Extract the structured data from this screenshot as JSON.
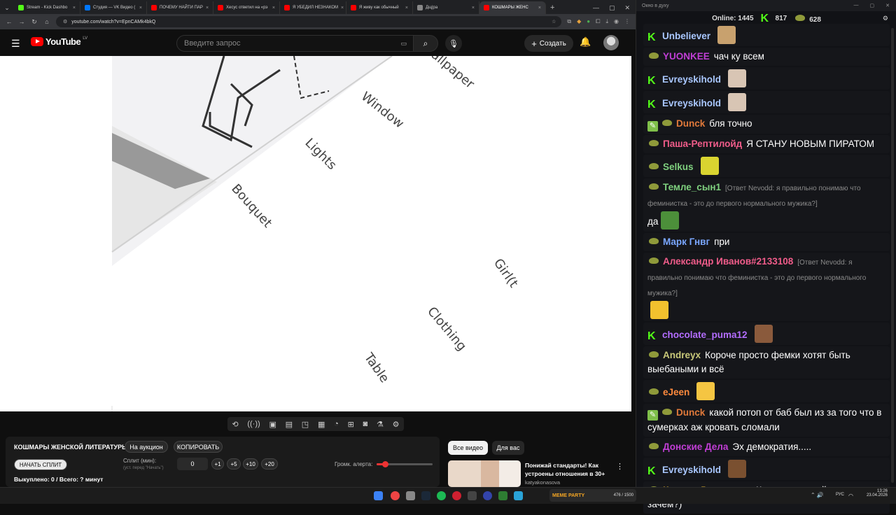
{
  "browser": {
    "tabs": [
      {
        "title": "Stream - Kick Dashbo",
        "color": "#53fc18"
      },
      {
        "title": "Студия — VK Видео (",
        "color": "#0077ff"
      },
      {
        "title": "ПОЧЕМУ НАЙТИ ПАР",
        "color": "#ff0000"
      },
      {
        "title": "Хесус ответил на «рэ",
        "color": "#ff0000"
      },
      {
        "title": "Я УБЕДИЛ НЕЗНАКОМ",
        "color": "#ff0000"
      },
      {
        "title": "Я живу как обычный",
        "color": "#ff0000"
      },
      {
        "title": "Дщ|ра",
        "color": "#888888"
      },
      {
        "title": "КОШМАРЫ ЖЕНС",
        "color": "#ff0000",
        "active": true
      }
    ],
    "url": "youtube.com/watch?v=EpnCAMk4bkQ"
  },
  "youtube": {
    "logo_text": "YouTube",
    "region": "LV",
    "search_placeholder": "Введите запрос",
    "create_label": "Создать"
  },
  "video_words": [
    "Window",
    "Lights",
    "Bouquet",
    "Clothing",
    "Table",
    "Girl(t",
    "allpaper"
  ],
  "panel": {
    "title": "КОШМАРЫ ЖЕНСКОЙ ЛИТЕРАТУРЫ",
    "auction_btn": "На аукцион",
    "copy_btn": "КОПИРОВАТЬ",
    "start_split_btn": "НАЧАТЬ СПЛИТ",
    "split_label": "Сплит (мин):",
    "split_hint": "(уст. перед \"Начать\")",
    "split_value": "0",
    "inc_buttons": [
      "+1",
      "+5",
      "+10",
      "+20"
    ],
    "volume_label": "Громк. алерта:",
    "volume_level": 0.15,
    "bought_text": "Выкуплено: 0 / Всего: ? минут"
  },
  "recs": {
    "chips": [
      "Все видео",
      "Для вас"
    ],
    "video_title": "Понижай стандарты! Как устроены отношения в 30+",
    "channel": "katyakonasova"
  },
  "chat": {
    "window_title": "Окно в духу",
    "online_label": "Online:",
    "online_count": "1445",
    "kick_count": "817",
    "vk_count": "628",
    "messages": [
      {
        "badge": "kick",
        "name": "Unbeliever",
        "color": "#a9c7ff",
        "text": "",
        "emote": "#c8a16e"
      },
      {
        "badge": "frog",
        "name": "YUONKEE",
        "color": "#c13ed6",
        "text": "чач ку всем"
      },
      {
        "badge": "kick",
        "name": "Evreyskihold",
        "color": "#a9c7ff",
        "text": "",
        "emote": "#d8c5b4"
      },
      {
        "badge": "kick",
        "name": "Evreyskihold",
        "color": "#a9c7ff",
        "text": "",
        "emote": "#d8c5b4"
      },
      {
        "badge": "modfrog",
        "name": "Dunck",
        "color": "#e0793a",
        "text": "бля точно"
      },
      {
        "badge": "frog",
        "name": "Паша-Рептилойд",
        "color": "#f05c8a",
        "text": "Я СТАНУ НОВЫМ ПИРАТОМ"
      },
      {
        "badge": "frog",
        "name": "Selkus",
        "color": "#7fd17f",
        "text": "",
        "emote": "#d9d430"
      },
      {
        "badge": "frog",
        "name": "Темле_сын1",
        "color": "#7fd17f",
        "reply": "[Ответ Nevodd: я правильно понимаю что феминистка - это до первого нормального мужика?]",
        "text": "да",
        "emote": "#4c8f3a"
      },
      {
        "badge": "frog",
        "name": "Марк Гнвг",
        "color": "#7aa7ff",
        "text": "при"
      },
      {
        "badge": "frog",
        "name": "Александр Иванов#2133108",
        "color": "#f05c8a",
        "reply": "[Ответ Nevodd: я правильно понимаю что феминистка - это до первого нормального мужика?]",
        "text": "",
        "emote": "#f2c12e"
      },
      {
        "badge": "kick",
        "name": "chocolate_puma12",
        "color": "#b36dff",
        "text": "",
        "emote": "#8a5a3c"
      },
      {
        "badge": "frog",
        "name": "Andreyx",
        "color": "#c9c97a",
        "text": "Короче просто фемки хотят быть выебаными и всё"
      },
      {
        "badge": "frog",
        "name": "eJeen",
        "color": "#ff8a3d",
        "text": "",
        "emote": "#f5c542"
      },
      {
        "badge": "modfrog",
        "name": "Dunck",
        "color": "#e0793a",
        "text": "какой потоп от баб был из за того что в сумерках аж кровать сломали"
      },
      {
        "badge": "frog",
        "name": "Донские Дела",
        "color": "#c13ed6",
        "text": "Эх демократия....."
      },
      {
        "badge": "kick",
        "name": "Evreyskihold",
        "color": "#a9c7ff",
        "text": "",
        "emote": "#7a5030"
      },
      {
        "badge": "frog",
        "name": "Келлер Доминатор",
        "color": "#f2c12e",
        "text": "К терапевту пойти можно, но зачем?)"
      }
    ]
  },
  "taskbar": {
    "lang": "РУС",
    "time": "13:26",
    "date": "23.04.2026",
    "widget_text": "MEME PARTY",
    "widget_counter": "476 / 1500"
  }
}
